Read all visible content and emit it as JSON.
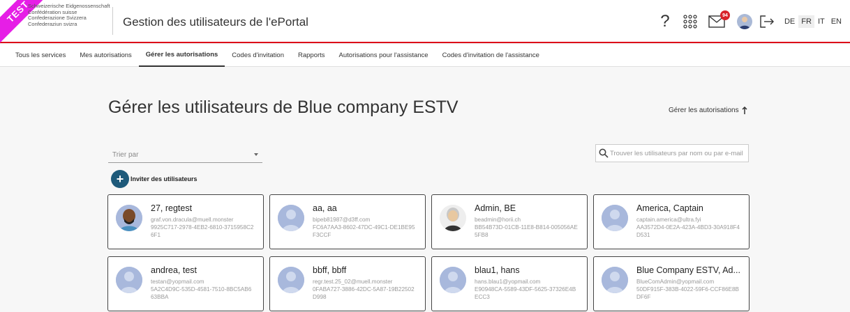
{
  "header": {
    "test_ribbon": "TEST",
    "federal_lines": [
      "Schweizerische Eidgenossenschaft",
      "Confédération suisse",
      "Confederazione Svizzera",
      "Confederaziun svizra"
    ],
    "app_title": "Gestion des utilisateurs de l'ePortal",
    "help_icon": "question-mark",
    "mail_badge": "94",
    "languages": [
      "DE",
      "FR",
      "IT",
      "EN"
    ],
    "active_language": "FR"
  },
  "nav": {
    "tabs": [
      {
        "label": "Tous les services"
      },
      {
        "label": "Mes autorisations"
      },
      {
        "label": "Gérer les autorisations"
      },
      {
        "label": "Codes d'invitation"
      },
      {
        "label": "Rapports"
      },
      {
        "label": "Autorisations pour l'assistance"
      },
      {
        "label": "Codes d'invitation de l'assistance"
      }
    ],
    "active_tab": "Gérer les autorisations"
  },
  "main": {
    "title": "Gérer les utilisateurs de Blue company ESTV",
    "manage_link": "Gérer les autorisations",
    "sort_placeholder": "Trier par",
    "search_placeholder": "Trouver les utilisateurs par nom ou par e-mail",
    "invite_label": "Inviter des utilisateurs"
  },
  "users": [
    {
      "name": "27, regtest",
      "email": "graf.von.dracula@muell.monster",
      "uid": "9925C717-2978-4EB2-6810-3715958C26F1",
      "avatar": "custom-dark"
    },
    {
      "name": "aa, aa",
      "email": "bipeb81987@d3ff.com",
      "uid": "FC6A7AA3-8602-47DC-49C1-DE1BE95F3CCF",
      "avatar": "default"
    },
    {
      "name": "Admin, BE",
      "email": "beadmin@horii.ch",
      "uid": "BB54B73D-01CB-11E8-B814-005056AE5FB8",
      "avatar": "custom-old"
    },
    {
      "name": "America, Captain",
      "email": "captain.america@ultra.fyi",
      "uid": "AA3572D4-0E2A-423A-4BD3-30A918F4D531",
      "avatar": "default"
    },
    {
      "name": "andrea, test",
      "email": "testan@yopmail.com",
      "uid": "5A2C4D9C-535D-4581-7510-8BC5AB663BBA",
      "avatar": "default"
    },
    {
      "name": "bbff, bbff",
      "email": "regr.test.25_02@muell.monster",
      "uid": "0FABA727-3886-42DC-5A87-19B22502D998",
      "avatar": "default"
    },
    {
      "name": "blau1, hans",
      "email": "hans.blau1@yopmail.com",
      "uid": "E90948CA-5589-43DF-5625-37326E4BECC3",
      "avatar": "default"
    },
    {
      "name": "Blue Company ESTV, Ad...",
      "email": "BlueComAdmin@yopmail.com",
      "uid": "50DF915F-383B-4022-59F6-CCF86E8BDF6F",
      "avatar": "default"
    }
  ],
  "colors": {
    "accent_red": "#dc0018",
    "invite_button": "#1e5a7a",
    "test_ribbon": "#e61ee6",
    "default_avatar": "#a8b8dc"
  }
}
